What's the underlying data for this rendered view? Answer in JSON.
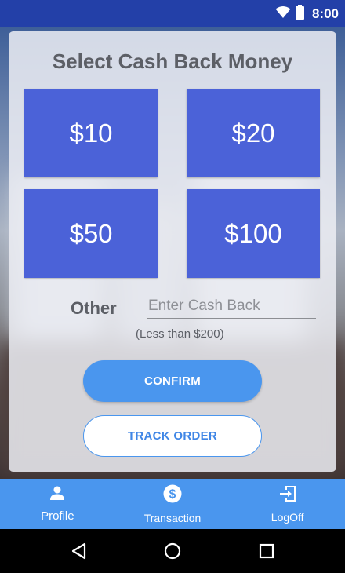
{
  "status_bar": {
    "time": "8:00",
    "icons": [
      "wifi-icon",
      "battery-icon"
    ]
  },
  "main": {
    "title": "Select Cash Back Money",
    "amounts": [
      "$10",
      "$20",
      "$50",
      "$100"
    ],
    "other_label": "Other",
    "cash_input": {
      "value": "",
      "placeholder": "Enter Cash Back"
    },
    "hint": "(Less than $200)",
    "confirm_label": "CONFIRM",
    "track_label": "TRACK ORDER"
  },
  "tab_bar": {
    "items": [
      {
        "label": "Profile",
        "icon": "person-icon"
      },
      {
        "label": "Transaction",
        "icon": "dollar-circle-icon"
      },
      {
        "label": "LogOff",
        "icon": "logoff-icon"
      }
    ]
  },
  "nav_bar": {
    "icons": [
      "back-icon",
      "home-icon",
      "recents-icon"
    ]
  },
  "colors": {
    "status_bar": "#2340a8",
    "amount_button": "#4b62d8",
    "accent": "#4a96ee",
    "text_gray": "#5c5f66"
  }
}
